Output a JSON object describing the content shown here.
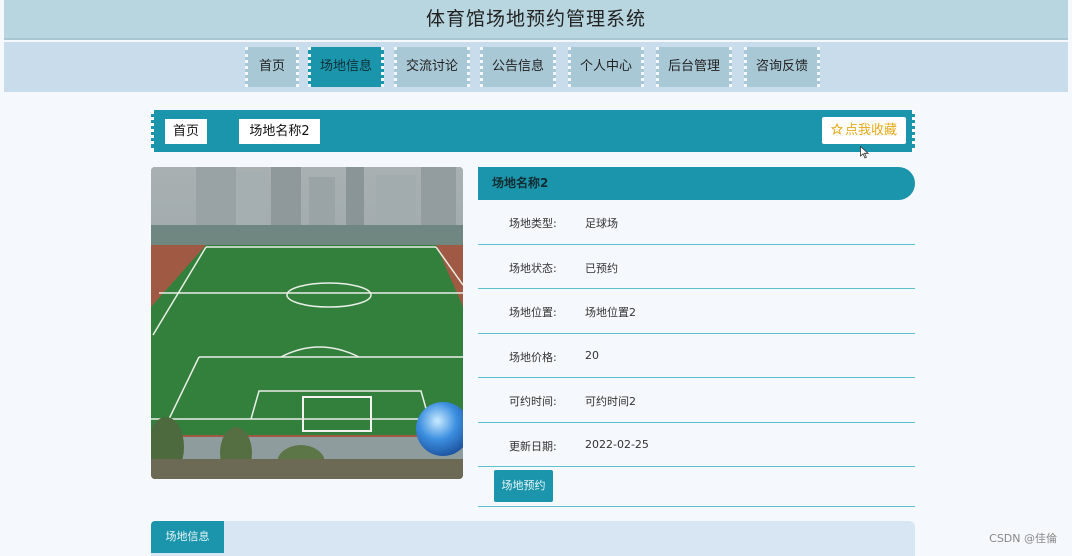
{
  "header": {
    "title": "体育馆场地预约管理系统"
  },
  "nav": {
    "items": [
      {
        "label": "首页"
      },
      {
        "label": "场地信息",
        "active": true
      },
      {
        "label": "交流讨论"
      },
      {
        "label": "公告信息"
      },
      {
        "label": "个人中心"
      },
      {
        "label": "后台管理"
      },
      {
        "label": "咨询反馈"
      }
    ]
  },
  "breadcrumb": {
    "home": "首页",
    "current": "场地名称2"
  },
  "favorite": {
    "icon": "star-icon",
    "label": "点我收藏"
  },
  "venue": {
    "name": "场地名称2",
    "image_icon": "soccer-field-photo",
    "fields": [
      {
        "label": "场地类型:",
        "value": "足球场"
      },
      {
        "label": "场地状态:",
        "value": "已预约"
      },
      {
        "label": "场地位置:",
        "value": "场地位置2"
      },
      {
        "label": "场地价格:",
        "value": "20"
      },
      {
        "label": "可约时间:",
        "value": "可约时间2"
      },
      {
        "label": "更新日期:",
        "value": "2022-02-25"
      }
    ],
    "book_label": "场地预约"
  },
  "tabs": {
    "active_label": "场地信息"
  },
  "watermark": "CSDN @佳倫",
  "colors": {
    "accent": "#1b95ab",
    "header_bg": "#b8d6e0",
    "nav_bg": "#c8dcec",
    "nav_item_bg": "#a8c8d6",
    "favorite_text": "#e6a917"
  }
}
